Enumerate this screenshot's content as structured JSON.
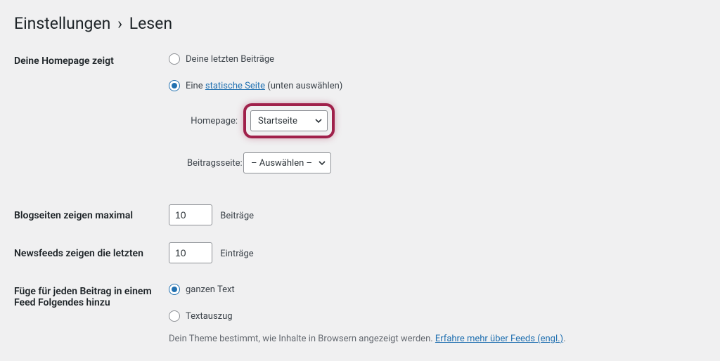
{
  "heading": {
    "prefix": "Einstellungen",
    "sep": "›",
    "suffix": "Lesen"
  },
  "rows": {
    "homepage": {
      "label": "Deine Homepage zeigt",
      "opt_posts": "Deine letzten Beiträge",
      "opt_static_prefix": "Eine ",
      "opt_static_link": "statische Seite",
      "opt_static_suffix": " (unten auswählen)",
      "homepage_label": "Homepage:",
      "homepage_value": "Startseite",
      "postspage_label": "Beitragsseite:",
      "postspage_value": "– Auswählen –"
    },
    "blog_max": {
      "label": "Blogseiten zeigen maximal",
      "value": "10",
      "unit": "Beiträge"
    },
    "feed_max": {
      "label": "Newsfeeds zeigen die letzten",
      "value": "10",
      "unit": "Einträge"
    },
    "feed_content": {
      "label": "Füge für jeden Beitrag in einem Feed Folgendes hinzu",
      "opt_full": "ganzen Text",
      "opt_excerpt": "Textauszug",
      "desc_text": "Dein Theme bestimmt, wie Inhalte in Browsern angezeigt werden. ",
      "desc_link": "Erfahre mehr über Feeds (engl.)",
      "desc_after": "."
    }
  }
}
